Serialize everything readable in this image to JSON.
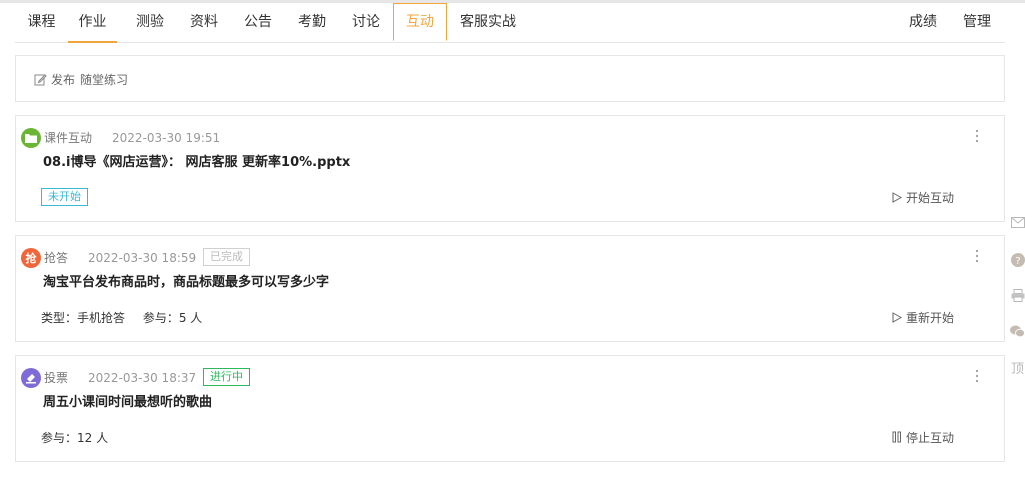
{
  "nav": {
    "tabs": [
      {
        "label": "课程"
      },
      {
        "label": "作业"
      },
      {
        "label": "测验"
      },
      {
        "label": "资料"
      },
      {
        "label": "公告"
      },
      {
        "label": "考勤"
      },
      {
        "label": "讨论"
      },
      {
        "label": "互动"
      },
      {
        "label": "客服实战"
      }
    ],
    "right": [
      {
        "label": "成绩"
      },
      {
        "label": "管理"
      }
    ]
  },
  "publish": {
    "action": "发布",
    "target": "随堂练习"
  },
  "cards": [
    {
      "type": "课件互动",
      "time": "2022-03-30 19:51",
      "title": "08.i博导《网店运营》： 网店客服 更新率10%.pptx",
      "status": "未开始",
      "action": "开始互动"
    },
    {
      "type": "抢答",
      "icon_text": "抢",
      "time": "2022-03-30 18:59",
      "status": "已完成",
      "title": "淘宝平台发布商品时，商品标题最多可以写多少字",
      "meta_type_label": "类型：",
      "meta_type_value": "手机抢答",
      "meta_participants": "参与：5 人",
      "action": "重新开始"
    },
    {
      "type": "投票",
      "time": "2022-03-30 18:37",
      "status": "进行中",
      "title": "周五小课间时间最想听的歌曲",
      "meta_participants": "参与：12 人",
      "action": "停止互动"
    }
  ],
  "float_bar": {
    "top_text": "顶"
  },
  "colors": {
    "accent": "#f4a53a",
    "not_started": "#39b8d8",
    "in_progress": "#2db85e",
    "completed_border": "#d0d0d0"
  }
}
